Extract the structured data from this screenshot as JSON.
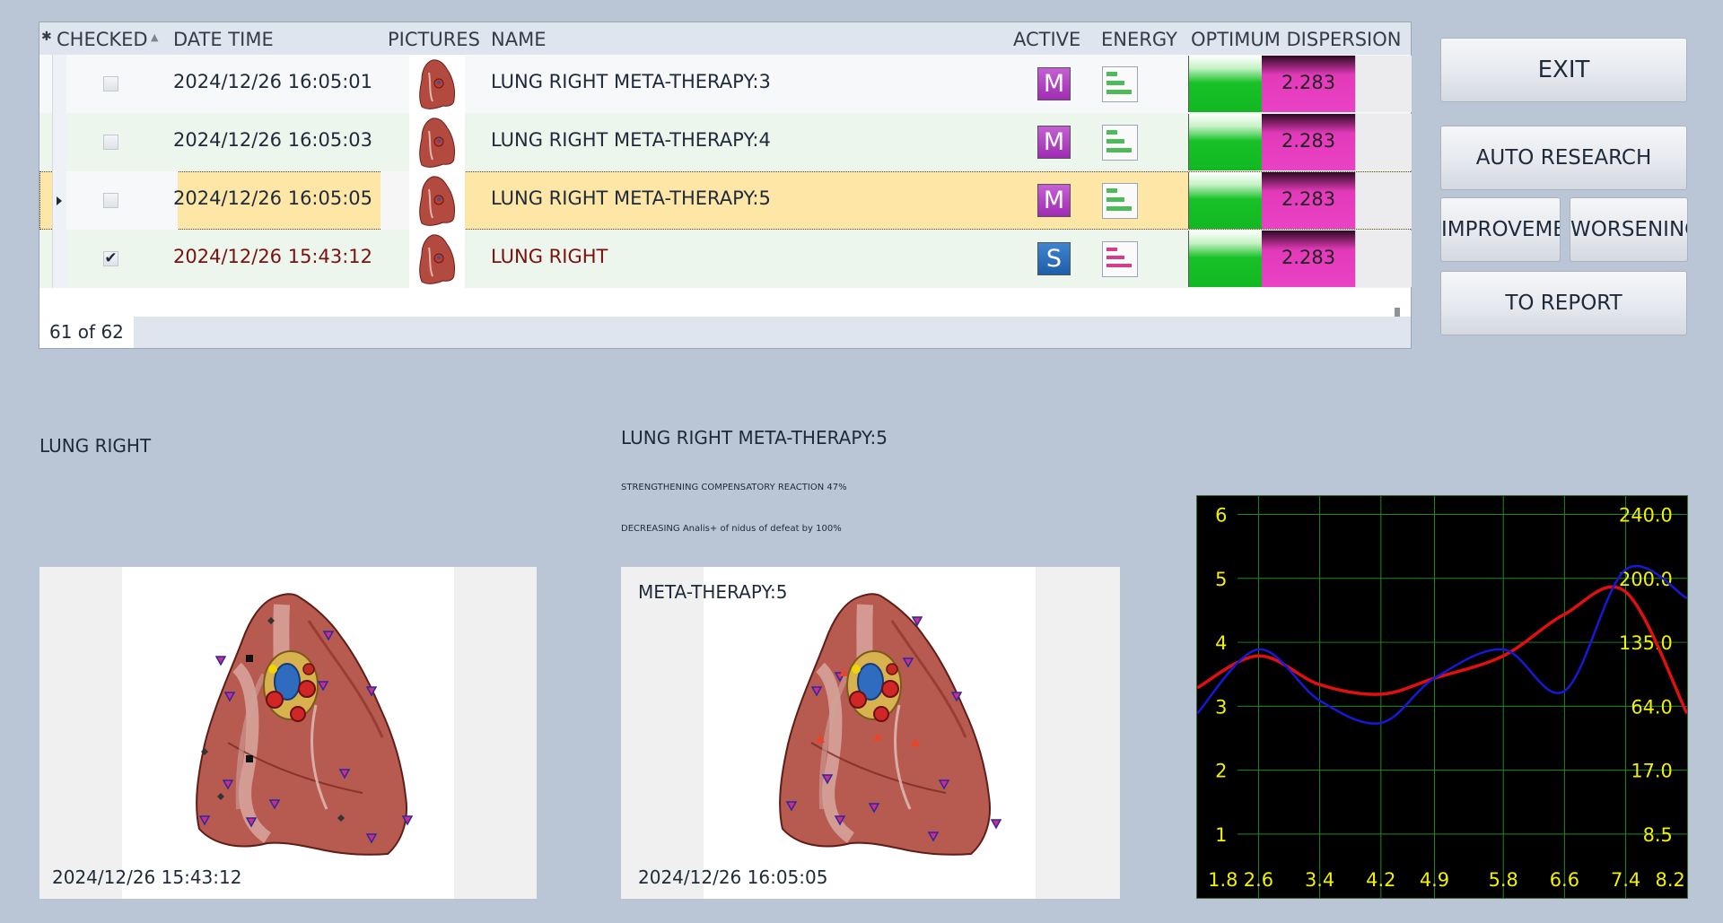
{
  "grid": {
    "columns": {
      "checked": "CHECKED",
      "date_time": "DATE  TIME",
      "pictures": "PICTURES",
      "name": "NAME",
      "active": "ACTIVE",
      "energy": "ENERGY",
      "optimum_dispersion": "OPTIMUM DISPERSION"
    },
    "rows": [
      {
        "checked": false,
        "date_time": "2024/12/26 16:05:01",
        "name": "LUNG RIGHT META-THERAPY:3",
        "active": "M",
        "dispersion": "2.283",
        "selected": false
      },
      {
        "checked": false,
        "date_time": "2024/12/26 16:05:03",
        "name": "LUNG RIGHT META-THERAPY:4",
        "active": "M",
        "dispersion": "2.283",
        "selected": false
      },
      {
        "checked": false,
        "date_time": "2024/12/26 16:05:05",
        "name": "LUNG RIGHT META-THERAPY:5",
        "active": "M",
        "dispersion": "2.283",
        "selected": true
      },
      {
        "checked": true,
        "check_mark": "✔",
        "date_time": "2024/12/26 15:43:12",
        "name": "LUNG RIGHT",
        "active": "S",
        "dispersion": "2.283",
        "selected": false
      }
    ],
    "record_count": "61 of 62"
  },
  "buttons": {
    "exit": "EXIT",
    "auto_research": "AUTO RESEARCH",
    "improvement": "IMPROVEMENT",
    "worsening": "WORSENING",
    "to_report": "TO REPORT"
  },
  "left_panel": {
    "title": "LUNG RIGHT",
    "timestamp": "2024/12/26 15:43:12"
  },
  "right_panel": {
    "title": "LUNG RIGHT META-THERAPY:5",
    "note_1": "STRENGTHENING COMPENSATORY REACTION 47%",
    "note_2": "DECREASING Analis+ of nidus of defeat by 100%",
    "image_label": "META-THERAPY:5",
    "timestamp": "2024/12/26 16:05:05"
  },
  "colors": {
    "row_white": "#f6f8fa",
    "row_green": "#ecf6ec",
    "row_selected": "#fde6a6",
    "row_alt_text": "#7a1010",
    "active_m": "#a02bb4",
    "active_s": "#1f5ea8",
    "chart_red": "#e01010",
    "chart_blue": "#1818d8",
    "chart_grid": "#1f8a1f",
    "chart_text": "#f2f200"
  },
  "chart_data": {
    "type": "line",
    "x_ticks": [
      "1.8",
      "2.6",
      "3.4",
      "4.2",
      "4.9",
      "5.8",
      "6.6",
      "7.4",
      "8.2"
    ],
    "y_left_ticks": [
      "1",
      "2",
      "3",
      "4",
      "5",
      "6"
    ],
    "y_right_ticks": [
      "8.5",
      "17.0",
      "64.0",
      "135.0",
      "200.0",
      "240.0"
    ],
    "xlim": [
      1.8,
      8.2
    ],
    "ylim": [
      0.7,
      6.4
    ],
    "grid": true,
    "series": [
      {
        "color": "red",
        "x": [
          1.8,
          2.6,
          3.4,
          4.2,
          4.9,
          5.8,
          6.6,
          7.4,
          8.2
        ],
        "y": [
          3.4,
          3.9,
          3.45,
          3.3,
          3.55,
          3.9,
          4.55,
          4.9,
          3.0
        ]
      },
      {
        "color": "blue",
        "x": [
          1.8,
          2.6,
          3.4,
          4.2,
          4.9,
          5.8,
          6.6,
          7.4,
          8.2
        ],
        "y": [
          3.0,
          4.0,
          3.2,
          2.85,
          3.55,
          4.0,
          3.35,
          5.25,
          4.8
        ]
      }
    ]
  }
}
